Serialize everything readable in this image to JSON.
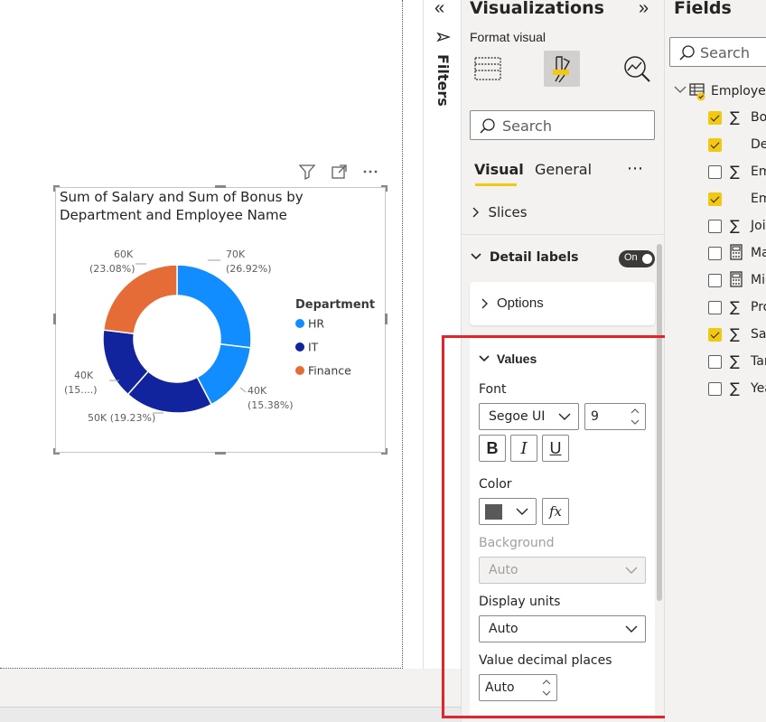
{
  "visual": {
    "title": "Sum of Salary and Sum of Bonus by Department and Employee Name",
    "title_line1": "Sum of Salary and Sum of Bonus by",
    "title_line2": "Department and Employee Name"
  },
  "chart_data": {
    "type": "pie",
    "subtype": "donut",
    "title": "Sum of Salary and Sum of Bonus by Department and Employee Name",
    "legend_title": "Department",
    "legend_position": "right",
    "categories": [
      "HR",
      "IT",
      "Finance"
    ],
    "colors": {
      "HR": "#118dff",
      "IT": "#12239e",
      "Finance": "#e66c37"
    },
    "slices": [
      {
        "department": "HR",
        "value": 70000,
        "label": "70K",
        "pct_label": "(26.92%)",
        "color": "#118dff"
      },
      {
        "department": "HR",
        "value": 40000,
        "label": "40K",
        "pct_label": "(15.38%)",
        "color": "#118dff"
      },
      {
        "department": "IT",
        "value": 50000,
        "label": "50K (19.23%)",
        "pct_label": "",
        "color": "#12239e"
      },
      {
        "department": "IT",
        "value": 40000,
        "label": "40K",
        "pct_label": "(15....)",
        "color": "#12239e"
      },
      {
        "department": "Finance",
        "value": 60000,
        "label": "60K",
        "pct_label": "(23.08%)",
        "color": "#e66c37"
      }
    ]
  },
  "filters_pane": {
    "label": "Filters"
  },
  "viz_pane": {
    "title": "Visualizations",
    "format_visual": "Format visual",
    "search_placeholder": "Search",
    "tabs": [
      "Visual",
      "General"
    ],
    "more": "⋯",
    "sections": {
      "slices": "Slices",
      "detail_labels": "Detail labels",
      "detail_labels_toggle": "On",
      "options": "Options",
      "values": "Values"
    },
    "values": {
      "font_label": "Font",
      "font_family": "Segoe UI",
      "font_size": "9",
      "bold": "B",
      "italic": "I",
      "underline": "U",
      "color_label": "Color",
      "color_value": "#595959",
      "fx": "fx",
      "background_label": "Background",
      "background_value": "Auto",
      "display_units_label": "Display units",
      "display_units_value": "Auto",
      "decimal_places_label": "Value decimal places",
      "decimal_places_value": "Auto"
    }
  },
  "fields_pane": {
    "title": "Fields",
    "search_placeholder": "Search",
    "table_name": "Employee",
    "fields": [
      {
        "name": "Bonus",
        "checked": true,
        "type": "sum"
      },
      {
        "name": "Department",
        "checked": true,
        "type": "text"
      },
      {
        "name": "Employee ID",
        "checked": false,
        "type": "sum"
      },
      {
        "name": "Employee Name",
        "checked": true,
        "type": "text"
      },
      {
        "name": "Joining Year",
        "checked": false,
        "type": "sum"
      },
      {
        "name": "Max",
        "checked": false,
        "type": "calc"
      },
      {
        "name": "Min",
        "checked": false,
        "type": "calc"
      },
      {
        "name": "Projects",
        "checked": false,
        "type": "sum"
      },
      {
        "name": "Salary",
        "checked": true,
        "type": "sum"
      },
      {
        "name": "Target",
        "checked": false,
        "type": "sum"
      },
      {
        "name": "Year",
        "checked": false,
        "type": "sum"
      }
    ],
    "field_visible": [
      "Bo",
      "De",
      "Em",
      "Em",
      "Joi",
      "Ma",
      "Mi",
      "Pro",
      "Sal",
      "Tar",
      "Yea"
    ],
    "table_visible": "Employee"
  }
}
